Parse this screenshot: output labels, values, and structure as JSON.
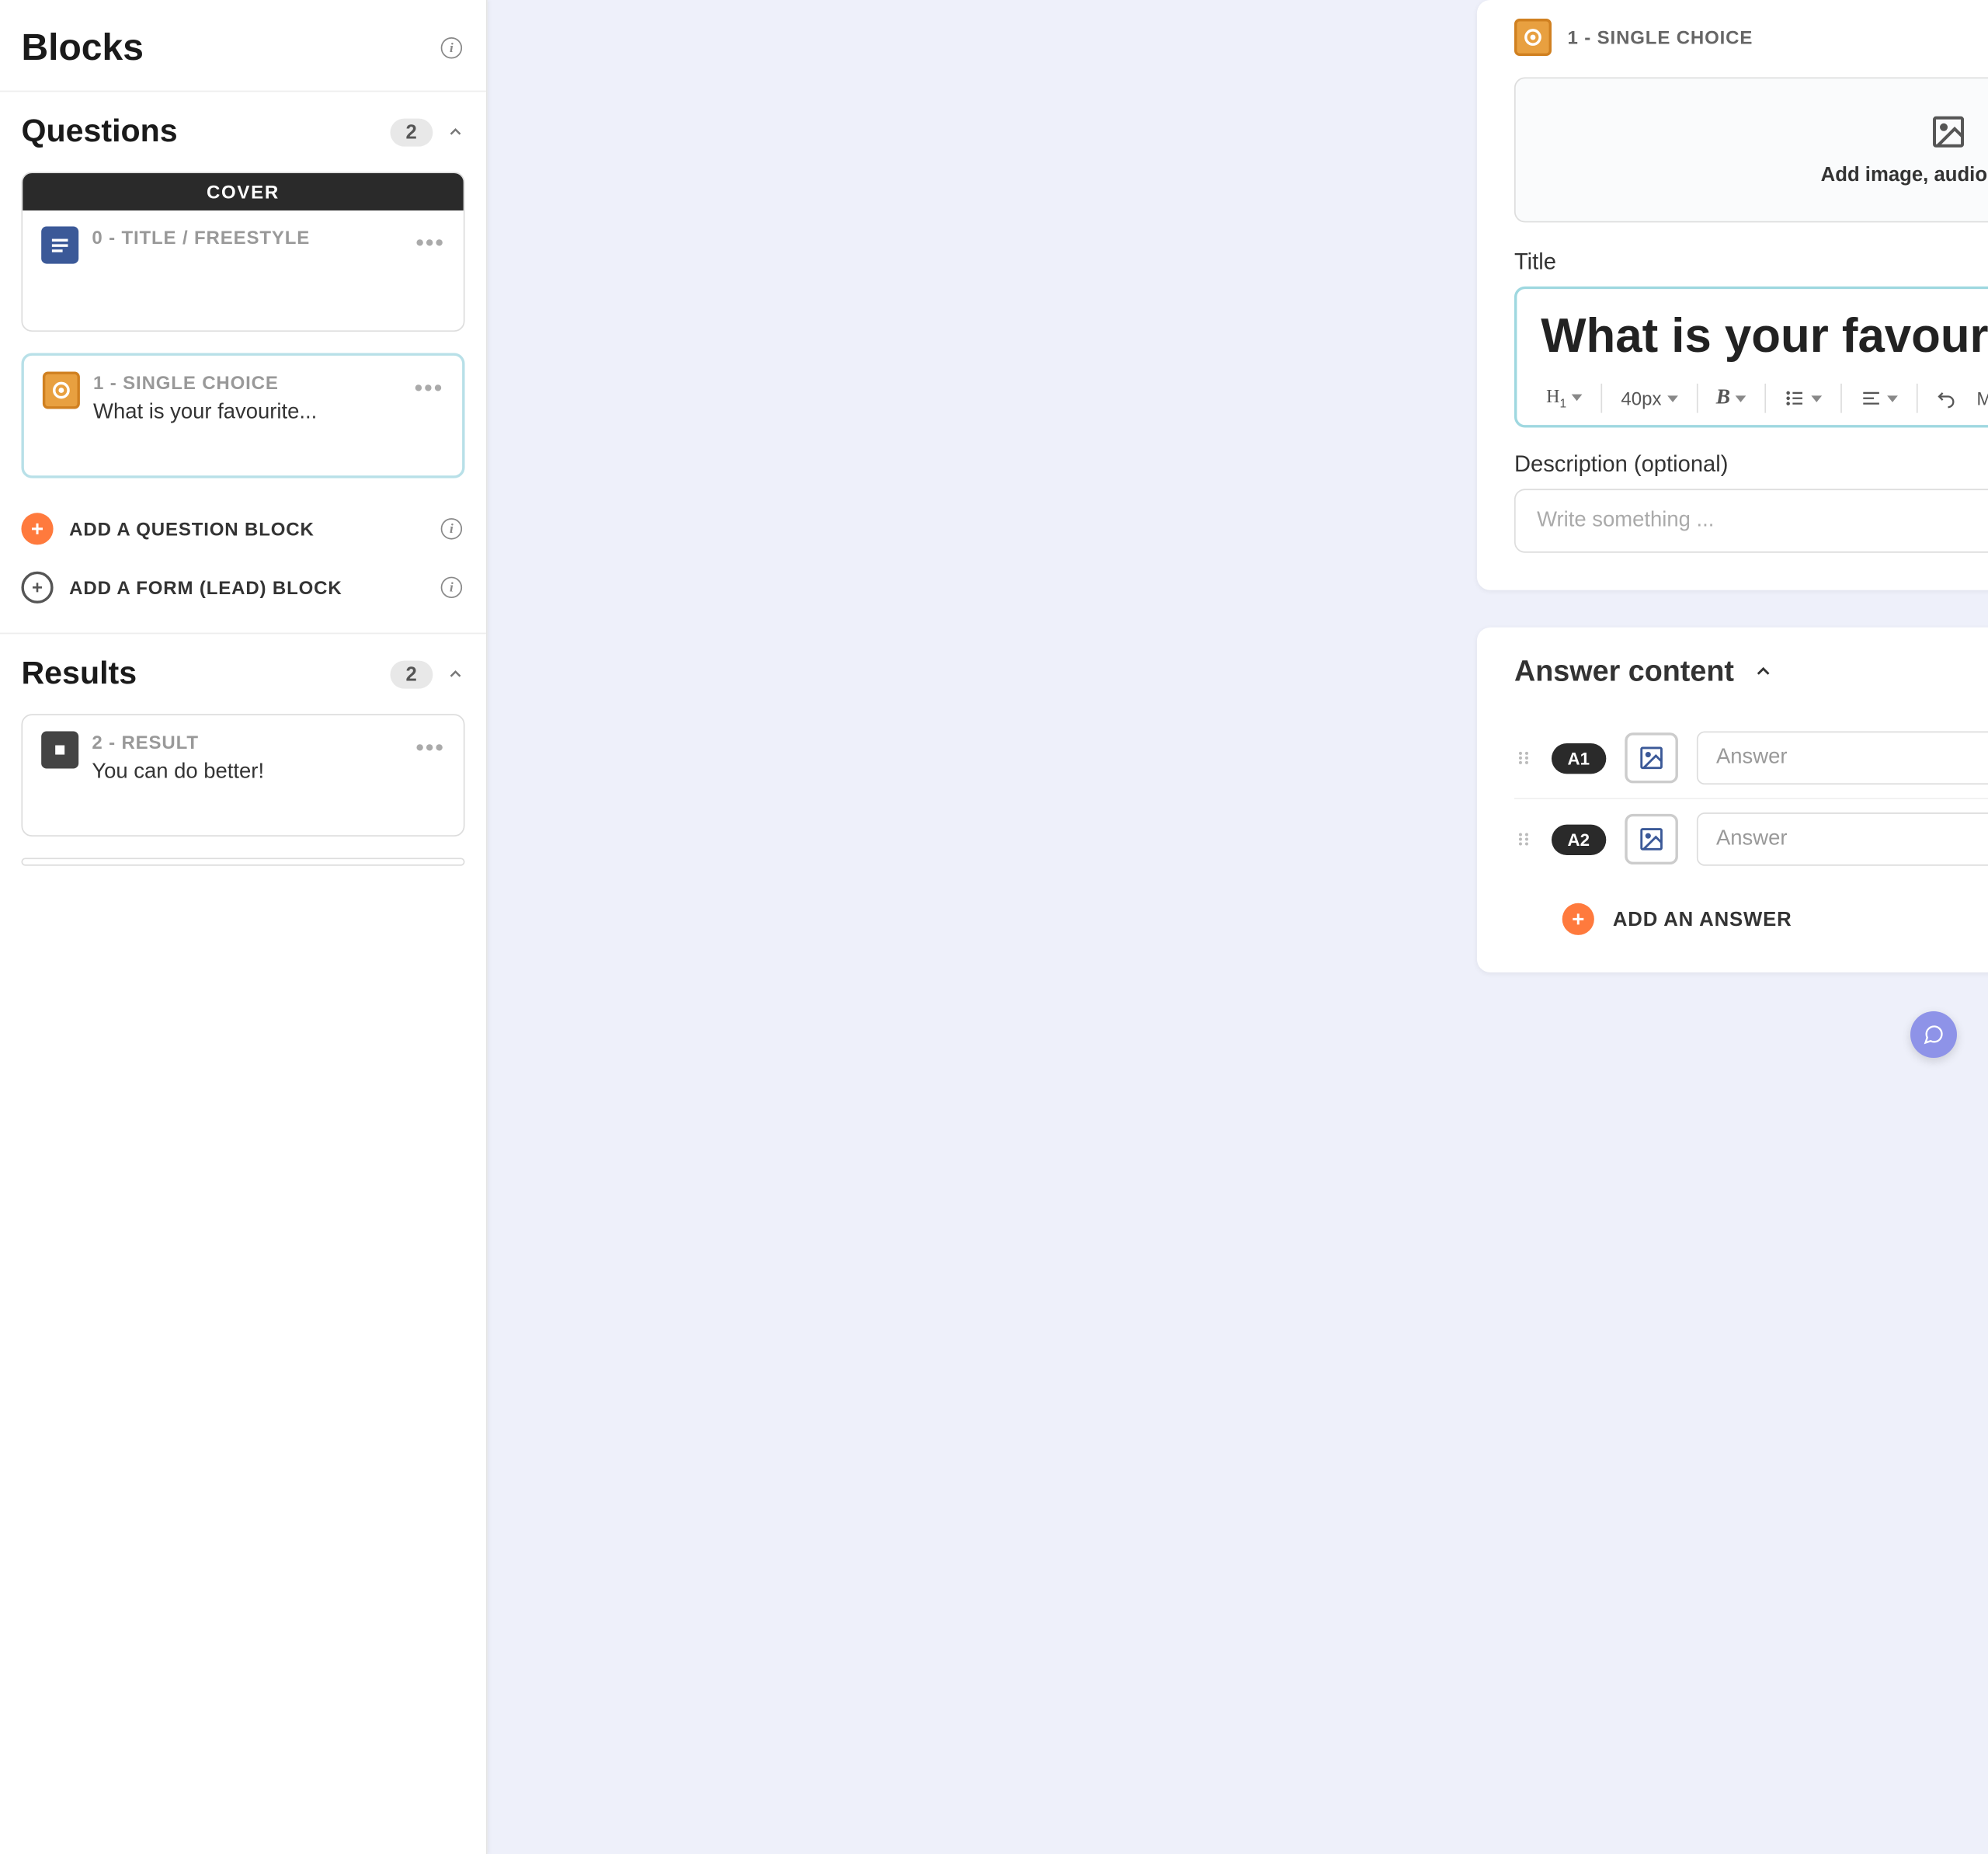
{
  "sidebar": {
    "title": "Blocks",
    "questions_header": "Questions",
    "questions_count": "2",
    "results_header": "Results",
    "results_count": "2",
    "cover_label": "COVER",
    "items": [
      {
        "label": "0 - TITLE / FREESTYLE",
        "preview": ""
      },
      {
        "label": "1 - SINGLE CHOICE",
        "preview": "What is your favourite..."
      }
    ],
    "add_question": "ADD A QUESTION BLOCK",
    "add_form": "ADD A FORM (LEAD) BLOCK",
    "results": [
      {
        "label": "2 - RESULT",
        "preview": "You can do better!"
      }
    ]
  },
  "editor": {
    "header_label": "1 - SINGLE CHOICE",
    "media_prompt": "Add image, audio, or video",
    "title_label": "Title",
    "title_value": "What is your favourite...",
    "font_size": "40px",
    "more_label": "More...",
    "desc_label": "Description (optional)",
    "desc_placeholder": "Write something ..."
  },
  "answers": {
    "section_title": "Answer content",
    "rows": [
      {
        "badge": "A1",
        "placeholder": "Answer",
        "correct": true
      },
      {
        "badge": "A2",
        "placeholder": "Answer",
        "correct": false
      }
    ],
    "add_label": "ADD AN ANSWER"
  }
}
